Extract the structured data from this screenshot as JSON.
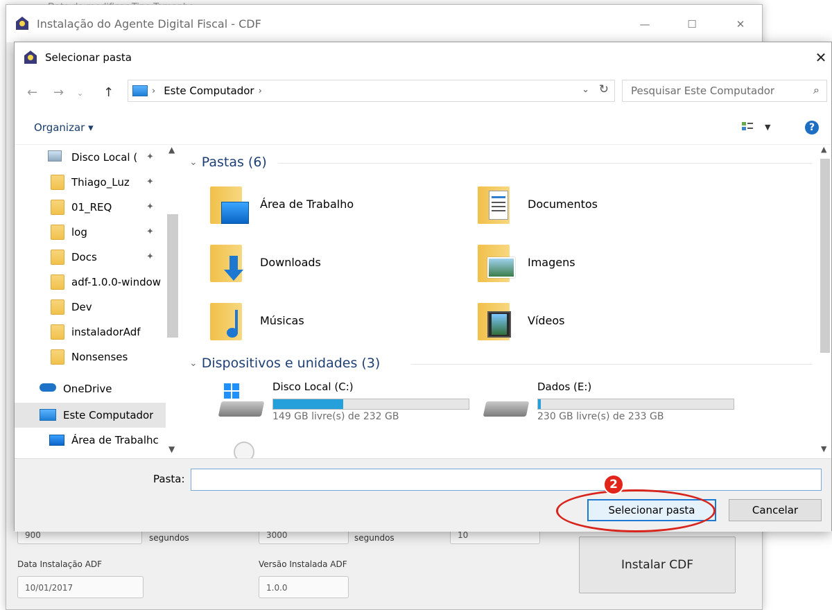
{
  "background_window": {
    "title": "Instalação do Agente Digital Fiscal - CDF",
    "partial_top_text": "Data de modificar    Tipo         Tamanho",
    "fields": [
      {
        "value": "900",
        "suffix": "segundos"
      },
      {
        "value": "3000",
        "suffix": "segundos"
      },
      {
        "value": "10"
      }
    ],
    "data_instalacao_label": "Data Instalação ADF",
    "data_instalacao_value": "10/01/2017",
    "versao_label": "Versão Instalada ADF",
    "versao_value": "1.0.0",
    "install_button": "Instalar CDF"
  },
  "dialog": {
    "title": "Selecionar pasta",
    "address": {
      "crumb": "Este Computador",
      "sep": "›",
      "search_placeholder": "Pesquisar Este Computador"
    },
    "toolbar": {
      "organize": "Organizar ▾",
      "help": "?"
    },
    "nav": {
      "items": [
        {
          "label": "Disco Local (C:)",
          "display": "Disco Local (",
          "pinned": true
        },
        {
          "label": "Thiago_Luz",
          "pinned": true
        },
        {
          "label": "01_REQ",
          "pinned": true
        },
        {
          "label": "log",
          "pinned": true
        },
        {
          "label": "Docs",
          "pinned": true
        },
        {
          "label": "adf-1.0.0-window",
          "pinned": false
        },
        {
          "label": "Dev",
          "pinned": false
        },
        {
          "label": "instaladorAdf",
          "pinned": false
        },
        {
          "label": "Nonsenses",
          "pinned": false
        },
        {
          "label": "OneDrive",
          "pinned": false
        },
        {
          "label": "Este Computador",
          "pinned": false,
          "selected": true
        },
        {
          "label": "Área de Trabalho",
          "display": "Área de Trabalhc",
          "pinned": false
        }
      ]
    },
    "folders_group": {
      "heading": "Pastas (6)",
      "items": [
        {
          "name": "Área de Trabalho",
          "icon": "desktop-folder-icon"
        },
        {
          "name": "Documentos",
          "icon": "documents-folder-icon"
        },
        {
          "name": "Downloads",
          "icon": "downloads-folder-icon"
        },
        {
          "name": "Imagens",
          "icon": "pictures-folder-icon"
        },
        {
          "name": "Músicas",
          "icon": "music-folder-icon"
        },
        {
          "name": "Vídeos",
          "icon": "videos-folder-icon"
        }
      ]
    },
    "drives_group": {
      "heading": "Dispositivos e unidades (3)",
      "items": [
        {
          "name": "Disco Local (C:)",
          "free_text": "149 GB livre(s) de 232 GB",
          "used_fraction": 0.358,
          "icon": "windows-drive-icon"
        },
        {
          "name": "Dados (E:)",
          "free_text": "230 GB livre(s) de 233 GB",
          "used_fraction": 0.013,
          "icon": "drive-icon"
        }
      ]
    },
    "folder_label": "Pasta:",
    "folder_value": "",
    "select_button": "Selecionar pasta",
    "cancel_button": "Cancelar"
  },
  "annotation": {
    "badge_number": "2",
    "color": "#d7241d"
  },
  "colors": {
    "accent": "#1e79d2",
    "progress": "#26a0da",
    "group_heading": "#1e3f75"
  }
}
